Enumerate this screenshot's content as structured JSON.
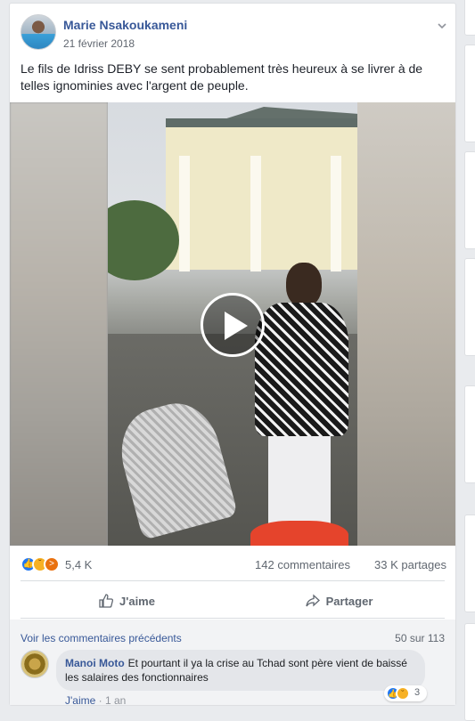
{
  "post": {
    "author": "Marie Nsakoukameni",
    "date": "21 février 2018",
    "text": "Le fils de Idriss DEBY se sent probablement très heureux à se livrer à de telles ignominies avec l'argent de peuple.",
    "video": {
      "play_icon": "play-icon"
    }
  },
  "stats": {
    "reaction_icons": [
      "like-icon",
      "sad-icon",
      "angry-icon"
    ],
    "reaction_count": "5,4 K",
    "comments": "142 commentaires",
    "shares": "33 K partages"
  },
  "actions": {
    "like_label": "J'aime",
    "share_label": "Partager"
  },
  "comments": {
    "view_previous": "Voir les commentaires précédents",
    "pager": "50 sur 113",
    "items": [
      {
        "author": "Manoi Moto",
        "text": "Et pourtant il ya la crise au Tchad sont père vient de baissé les salaires des fonctionnaires",
        "reaction_count": "3",
        "like_label": "J'aime",
        "separator": "·",
        "time": "1 an"
      }
    ]
  },
  "colors": {
    "link": "#385898",
    "like": "#2078f4",
    "background": "#e9ebee"
  }
}
